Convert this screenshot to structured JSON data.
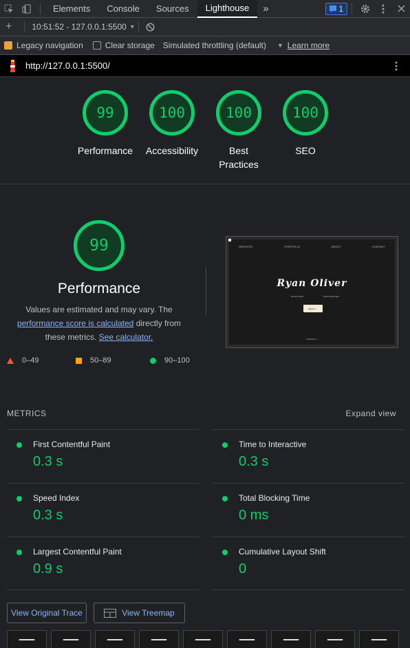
{
  "devtools": {
    "tabs": [
      "Elements",
      "Console",
      "Sources",
      "Lighthouse"
    ],
    "active_tab": "Lighthouse",
    "more_tabs": "»",
    "issues_count": "1"
  },
  "report_bar": {
    "add": "+",
    "report_time": "10:51:52 - 127.0.0.1:5500",
    "report_dropdown": "▾"
  },
  "options": {
    "legacy_nav_label": "Legacy navigation",
    "clear_storage_label": "Clear storage",
    "throttling_label": "Simulated throttling (default)",
    "learn_more": "Learn more"
  },
  "url": "http://127.0.0.1:5500/",
  "gauges": [
    {
      "score": "99",
      "label": "Performance"
    },
    {
      "score": "100",
      "label": "Accessibility"
    },
    {
      "score": "100",
      "label": "Best Practices"
    },
    {
      "score": "100",
      "label": "SEO"
    }
  ],
  "performance": {
    "score": "99",
    "title": "Performance",
    "desc_prefix": "Values are estimated and may vary. The ",
    "desc_link": "performance score is calculated",
    "desc_mid": " directly from these metrics. ",
    "desc_link2": "See calculator.",
    "legend": [
      "0–49",
      "50–89",
      "90–100"
    ]
  },
  "screenshot": {
    "nav": [
      "SERVICES",
      "PORTFOLIO",
      "ABOUT",
      "CONTACT"
    ],
    "name": "Ryan Oliver",
    "sub": [
      "DEVELOPER",
      "WEB DESIGNER"
    ],
    "cta": "BEGIN →",
    "footer": "LINKEDIN ↗"
  },
  "metrics_header": "METRICS",
  "expand_view": "Expand view",
  "metrics": [
    {
      "name": "First Contentful Paint",
      "value": "0.3 s"
    },
    {
      "name": "Time to Interactive",
      "value": "0.3 s"
    },
    {
      "name": "Speed Index",
      "value": "0.3 s"
    },
    {
      "name": "Total Blocking Time",
      "value": "0 ms"
    },
    {
      "name": "Largest Contentful Paint",
      "value": "0.9 s"
    },
    {
      "name": "Cumulative Layout Shift",
      "value": "0"
    }
  ],
  "buttons": {
    "view_trace": "View Original Trace",
    "view_treemap": "View Treemap"
  },
  "colors": {
    "pass": "#0cce6b",
    "average": "#ffa400",
    "fail": "#ff4e42",
    "link": "#8ab4f8"
  }
}
